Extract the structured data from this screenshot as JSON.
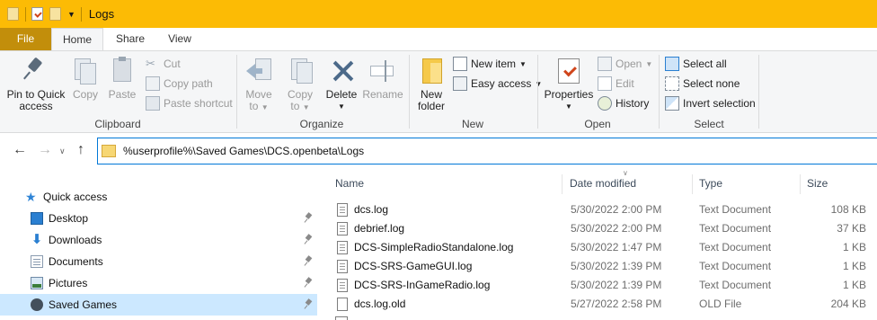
{
  "window": {
    "title": "Logs"
  },
  "ribbon_tabs": {
    "file": "File",
    "home": "Home",
    "share": "Share",
    "view": "View"
  },
  "clipboard": {
    "label": "Clipboard",
    "pin_line1": "Pin to Quick",
    "pin_line2": "access",
    "copy": "Copy",
    "paste": "Paste",
    "cut": "Cut",
    "copy_path": "Copy path",
    "paste_shortcut": "Paste shortcut"
  },
  "organize": {
    "label": "Organize",
    "move_to_line1": "Move",
    "move_to_line2": "to",
    "copy_to_line1": "Copy",
    "copy_to_line2": "to",
    "delete": "Delete",
    "rename": "Rename"
  },
  "new_group": {
    "label": "New",
    "new_folder_line1": "New",
    "new_folder_line2": "folder",
    "new_item": "New item",
    "easy_access": "Easy access"
  },
  "open_group": {
    "label": "Open",
    "properties": "Properties",
    "open": "Open",
    "edit": "Edit",
    "history": "History"
  },
  "select_group": {
    "label": "Select",
    "select_all": "Select all",
    "select_none": "Select none",
    "invert_selection": "Invert selection"
  },
  "address": {
    "path": "%userprofile%\\Saved Games\\DCS.openbeta\\Logs"
  },
  "nav_pane": {
    "quick_access": "Quick access",
    "items": [
      {
        "label": "Desktop",
        "icon": "desktop-icon"
      },
      {
        "label": "Downloads",
        "icon": "downloads-icon"
      },
      {
        "label": "Documents",
        "icon": "documents-icon"
      },
      {
        "label": "Pictures",
        "icon": "pictures-icon"
      },
      {
        "label": "Saved Games",
        "icon": "saved-games-icon"
      }
    ]
  },
  "columns": {
    "name": "Name",
    "date": "Date modified",
    "type": "Type",
    "size": "Size"
  },
  "files": [
    {
      "name": "dcs.log",
      "date": "5/30/2022 2:00 PM",
      "type": "Text Document",
      "size": "108 KB"
    },
    {
      "name": "debrief.log",
      "date": "5/30/2022 2:00 PM",
      "type": "Text Document",
      "size": "37 KB"
    },
    {
      "name": "DCS-SimpleRadioStandalone.log",
      "date": "5/30/2022 1:47 PM",
      "type": "Text Document",
      "size": "1 KB"
    },
    {
      "name": "DCS-SRS-GameGUI.log",
      "date": "5/30/2022 1:39 PM",
      "type": "Text Document",
      "size": "1 KB"
    },
    {
      "name": "DCS-SRS-InGameRadio.log",
      "date": "5/30/2022 1:39 PM",
      "type": "Text Document",
      "size": "1 KB"
    },
    {
      "name": "dcs.log.old",
      "date": "5/27/2022 2:58 PM",
      "type": "OLD File",
      "size": "204 KB"
    }
  ],
  "colors": {
    "titlebar": "#fcbb05",
    "file_tab": "#c28e0b",
    "accent": "#0078d7",
    "selected_nav": "#cce8ff"
  }
}
